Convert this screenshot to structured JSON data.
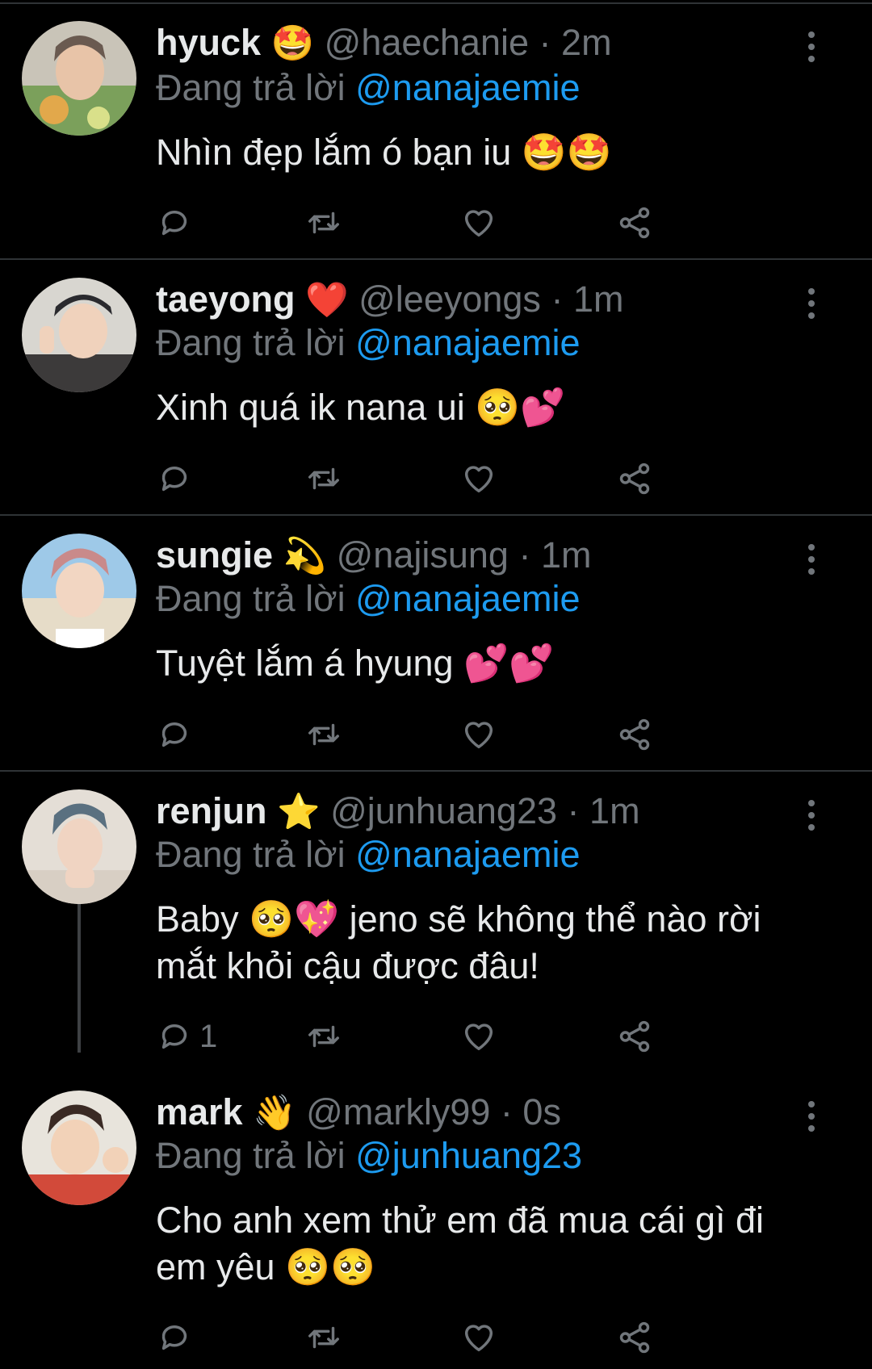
{
  "colors": {
    "background": "#000000",
    "text": "#e7e9ea",
    "muted": "#71767b",
    "link": "#1d9bf0",
    "divider": "#2f3336"
  },
  "replies": [
    {
      "name": "hyuck",
      "emoji": "🤩",
      "handle": "@haechanie",
      "time": "2m",
      "reply_prefix": "Đang trả lời",
      "reply_to": "@nanajaemie",
      "text": "Nhìn đẹp lắm ó bạn iu 🤩🤩",
      "reply_count": ""
    },
    {
      "name": "taeyong",
      "emoji": "❤️",
      "handle": "@leeyongs",
      "time": "1m",
      "reply_prefix": "Đang trả lời",
      "reply_to": "@nanajaemie",
      "text": "Xinh quá ik nana ui 🥺💕",
      "reply_count": ""
    },
    {
      "name": "sungie",
      "emoji": "💫",
      "handle": "@najisung",
      "time": "1m",
      "reply_prefix": "Đang trả lời",
      "reply_to": "@nanajaemie",
      "text": "Tuyệt lắm á hyung 💕💕",
      "reply_count": ""
    },
    {
      "name": "renjun",
      "emoji": "⭐",
      "handle": "@junhuang23",
      "time": "1m",
      "reply_prefix": "Đang trả lời",
      "reply_to": "@nanajaemie",
      "text": "Baby 🥺💖 jeno sẽ không thể nào rời mắt khỏi cậu được đâu!",
      "reply_count": "1"
    },
    {
      "name": "mark",
      "emoji": "👋",
      "handle": "@markly99",
      "time": "0s",
      "reply_prefix": "Đang trả lời",
      "reply_to": "@junhuang23",
      "text": "Cho anh xem thử em đã mua cái gì đi em yêu 🥺🥺",
      "reply_count": ""
    }
  ],
  "icons": {
    "reply": "reply-icon",
    "retweet": "retweet-icon",
    "like": "heart-icon",
    "share": "share-icon",
    "more": "more-vertical-icon"
  }
}
